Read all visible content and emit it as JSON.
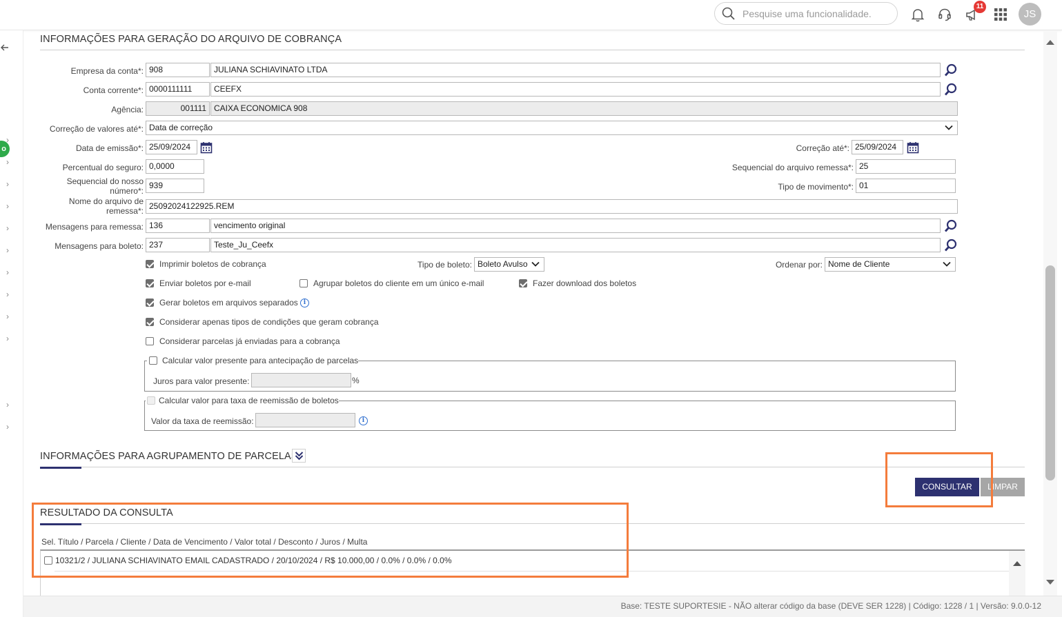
{
  "topbar": {
    "search_placeholder": "Pesquise uma funcionalidade.",
    "notification_count": "11",
    "avatar_initials": "JS"
  },
  "left_nav": {
    "active_letter": "o"
  },
  "section_generation": {
    "title": "INFORMAÇÕES PARA GERAÇÃO DO ARQUIVO DE COBRANÇA",
    "empresa_label": "Empresa da conta*:",
    "empresa_code": "908",
    "empresa_name": "JULIANA SCHIAVINATO LTDA",
    "conta_label": "Conta corrente*:",
    "conta_code": "0000111111",
    "conta_name": "CEEFX",
    "agencia_label": "Agência:",
    "agencia_code": "001111",
    "agencia_name": "CAIXA ECONOMICA 908",
    "correcao_valores_label": "Correção de valores até*:",
    "correcao_valores_value": "Data de correção",
    "data_emissao_label": "Data de emissão*:",
    "data_emissao_value": "25/09/2024",
    "correcao_ate_label": "Correção até*:",
    "correcao_ate_value": "25/09/2024",
    "percentual_label": "Percentual do seguro:",
    "percentual_value": "0,0000",
    "seq_arquivo_label": "Sequencial do arquivo remessa*:",
    "seq_arquivo_value": "25",
    "seq_nosso_label": "Sequencial do nosso número*:",
    "seq_nosso_value": "939",
    "tipo_mov_label": "Tipo de movimento*:",
    "tipo_mov_value": "01",
    "nome_arquivo_label": "Nome do arquivo de remessa*:",
    "nome_arquivo_value": "25092024122925.REM",
    "msg_remessa_label": "Mensagens para remessa:",
    "msg_remessa_code": "136",
    "msg_remessa_text": "vencimento original",
    "msg_boleto_label": "Mensagens para boleto:",
    "msg_boleto_code": "237",
    "msg_boleto_text": "Teste_Ju_Ceefx",
    "imprimir_label": "Imprimir boletos de cobrança",
    "tipo_boleto_label": "Tipo de boleto:",
    "tipo_boleto_value": "Boleto Avulso",
    "ordenar_label": "Ordenar por:",
    "ordenar_value": "Nome de Cliente",
    "enviar_email_label": "Enviar boletos por e-mail",
    "agrupar_label": "Agrupar boletos do cliente em um único e-mail",
    "download_label": "Fazer download dos boletos",
    "gerar_separados_label": "Gerar boletos em arquivos separados",
    "considerar_tipos_label": "Considerar apenas tipos de condições que geram cobrança",
    "considerar_parcelas_label": "Considerar parcelas já enviadas para a cobrança",
    "valor_presente_legend": "Calcular valor presente para antecipação de parcelas",
    "juros_label": "Juros para valor presente:",
    "juros_suffix": "%",
    "taxa_legend": "Calcular valor para taxa de reemissão de boletos",
    "taxa_label": "Valor da taxa de reemissão:"
  },
  "section_grouping": {
    "title": "INFORMAÇÕES PARA AGRUPAMENTO DE PARCELAS"
  },
  "actions": {
    "consultar": "CONSULTAR",
    "limpar": "LIMPAR"
  },
  "results": {
    "title": "RESULTADO DA CONSULTA",
    "header": "Sel. Título / Parcela / Cliente / Data de Vencimento / Valor total / Desconto / Juros / Multa",
    "rows": [
      {
        "text": "10321/2 / JULIANA SCHIAVINATO EMAIL CADASTRADO / 20/10/2024 / R$ 10.000,00 / 0.0% / 0.0% / 0.0%"
      }
    ]
  },
  "footer": {
    "text": "Base: TESTE SUPORTESIE - NÃO alterar código da base (DEVE SER 1228)  |  Código: 1228 / 1  |  Versão: 9.0.0-12"
  },
  "colors": {
    "primary": "#2d3170",
    "highlight": "#f47c3c",
    "badge": "#e53935",
    "info_blue": "#2f6fcf"
  }
}
